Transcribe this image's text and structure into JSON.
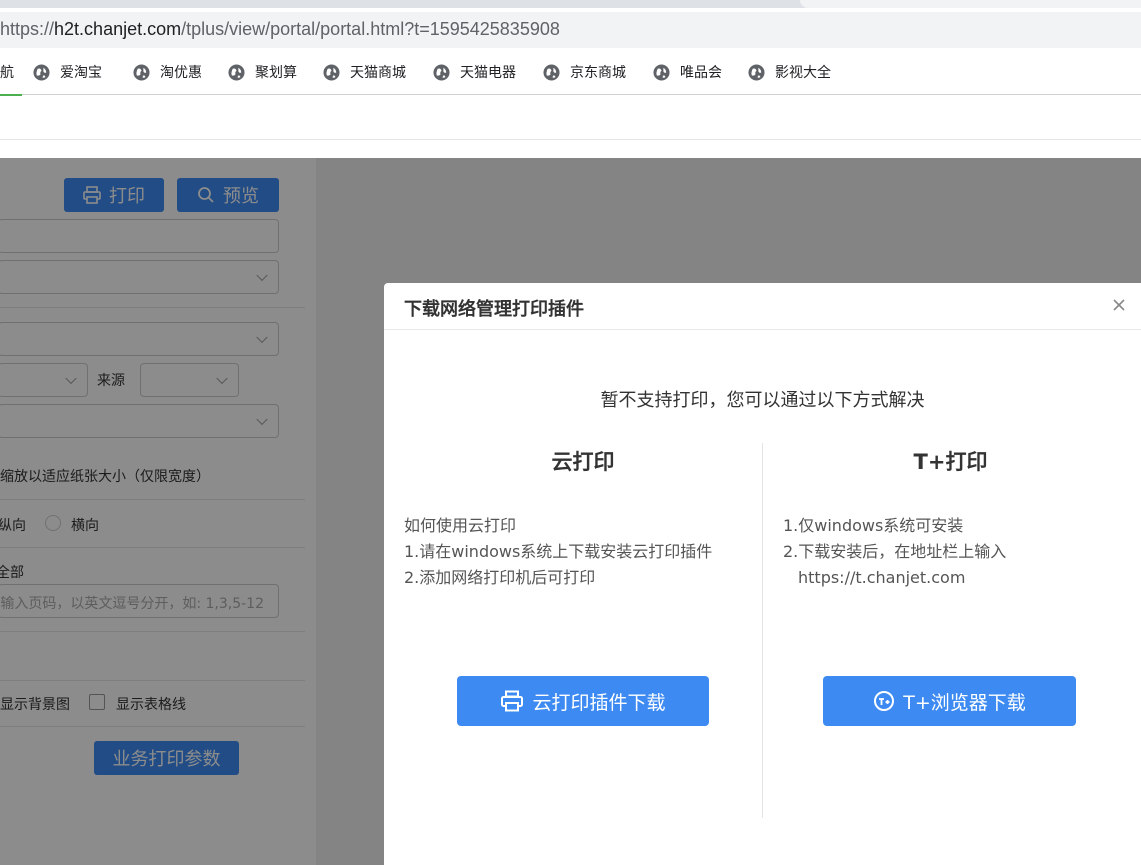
{
  "browser": {
    "url_prefix": "https://",
    "url_host": "h2t.chanjet.com",
    "url_rest": "/tplus/view/portal/portal.html?t=1595425835908",
    "bookmarks": [
      "航",
      "爱淘宝",
      "淘优惠",
      "聚划算",
      "天猫商城",
      "天猫电器",
      "京东商城",
      "唯品会",
      "影视大全"
    ]
  },
  "print_panel": {
    "print_label": "打印",
    "preview_label": "预览",
    "source_label": "来源",
    "scale_label": "缩放以适应纸张大小（仅限宽度）",
    "portrait_label": "纵向",
    "landscape_label": "横向",
    "range_all_label": "全部",
    "pages_placeholder": "输入页码，以英文逗号分开，如: 1,3,5-12",
    "show_bg_label": "显示背景图",
    "show_grid_label": "显示表格线",
    "params_button": "业务打印参数"
  },
  "dialog": {
    "title": "下载网络管理打印插件",
    "subtitle": "暂不支持打印，您可以通过以下方式解决",
    "cloud": {
      "title": "云打印",
      "lines": [
        "如何使用云打印",
        "1.请在windows系统上下载安装云打印插件",
        "2.添加网络打印机后可打印"
      ],
      "button": "云打印插件下载"
    },
    "tplus": {
      "title": "T+打印",
      "lines": [
        "1.仅windows系统可安装",
        "2.下载安装后，在地址栏上输入",
        "https://t.chanjet.com"
      ],
      "button": "T+浏览器下载"
    }
  },
  "colors": {
    "accent": "#3d8bf2",
    "mask": "rgba(0,0,0,0.45)"
  }
}
